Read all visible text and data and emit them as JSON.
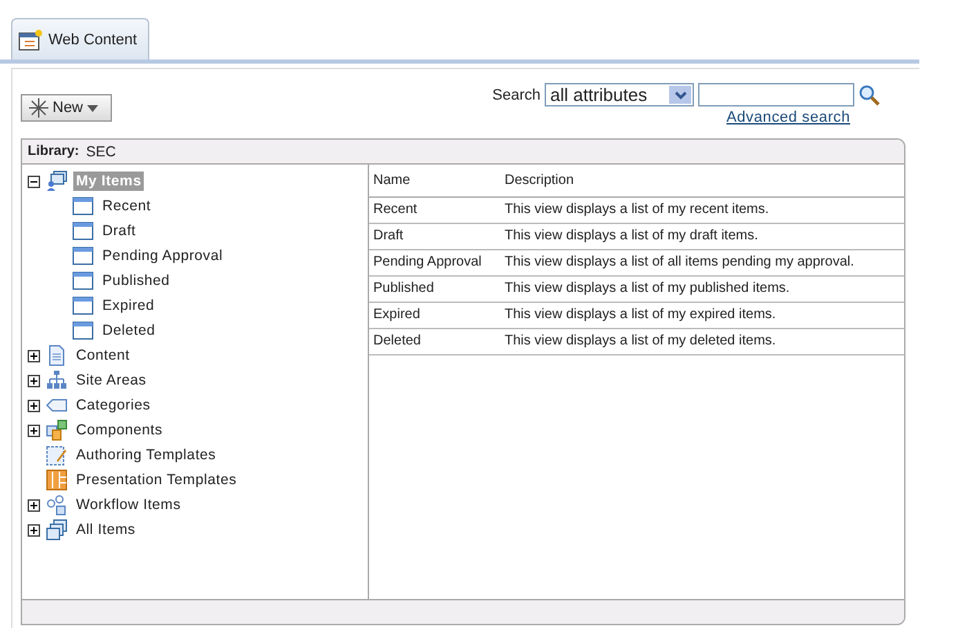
{
  "tabs": [
    {
      "label": "Web Content",
      "selected": true
    }
  ],
  "new_button": {
    "label": "New"
  },
  "search": {
    "label": "Search",
    "scope": "all attributes",
    "link": "Advanced search"
  },
  "library": {
    "label": "Library:",
    "name": "SEC"
  },
  "tree": [
    {
      "label": "My Items",
      "kind": "people",
      "expanded": true,
      "selected": true,
      "children": [
        {
          "label": "Recent",
          "kind": "view",
          "selected": false
        },
        {
          "label": "Draft",
          "kind": "view",
          "selected": false
        },
        {
          "label": "Pending Approval",
          "kind": "view",
          "selected": false
        },
        {
          "label": "Published",
          "kind": "view",
          "selected": false
        },
        {
          "label": "Expired",
          "kind": "view",
          "selected": false
        },
        {
          "label": "Deleted",
          "kind": "view",
          "selected": false
        }
      ]
    },
    {
      "label": "Content",
      "kind": "document",
      "expanded": false,
      "selected": false
    },
    {
      "label": "Site Areas",
      "kind": "sitemap",
      "expanded": false,
      "selected": false
    },
    {
      "label": "Categories",
      "kind": "tag",
      "expanded": false,
      "selected": false
    },
    {
      "label": "Components",
      "kind": "components",
      "expanded": false,
      "selected": false
    },
    {
      "label": "Authoring Templates",
      "kind": "authoring",
      "selected": false
    },
    {
      "label": "Presentation Templates",
      "kind": "presentation",
      "selected": false
    },
    {
      "label": "Workflow Items",
      "kind": "workflow",
      "expanded": false,
      "selected": false
    },
    {
      "label": "All Items",
      "kind": "stack",
      "expanded": false,
      "selected": false
    }
  ],
  "table": {
    "columns": [
      "Name",
      "Description"
    ],
    "rows": [
      [
        "Recent",
        "This view displays a list of my recent items."
      ],
      [
        "Draft",
        "This view displays a list of my draft items."
      ],
      [
        "Pending Approval",
        "This view displays a list of all items pending my approval."
      ],
      [
        "Published",
        "This view displays a list of my published items."
      ],
      [
        "Expired",
        "This view displays a list of my expired items."
      ],
      [
        "Deleted",
        "This view displays a list of my deleted items."
      ]
    ]
  }
}
